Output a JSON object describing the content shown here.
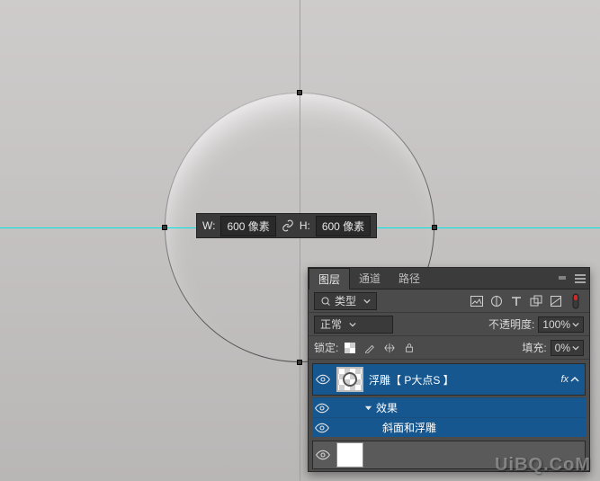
{
  "guides": {
    "v1": 333,
    "h1": 253
  },
  "overlay": {
    "w_label": "W:",
    "w_value": "600 像素",
    "h_label": "H:",
    "h_value": "600 像素"
  },
  "panel": {
    "tabs": {
      "layers": "图层",
      "channels": "通道",
      "paths": "路径"
    },
    "filter": {
      "kind_label": "类型"
    },
    "blend": {
      "mode": "正常",
      "opacity_label": "不透明度:",
      "opacity_value": "100%"
    },
    "lock": {
      "label": "锁定:",
      "fill_label": "填充:",
      "fill_value": "0%"
    },
    "layers_list": {
      "layer1_name": "浮雕【 P大点S 】",
      "effects_label": "效果",
      "effect1_label": "斜面和浮雕",
      "fx_badge": "fx"
    }
  },
  "watermark": "UiBQ.CoM"
}
